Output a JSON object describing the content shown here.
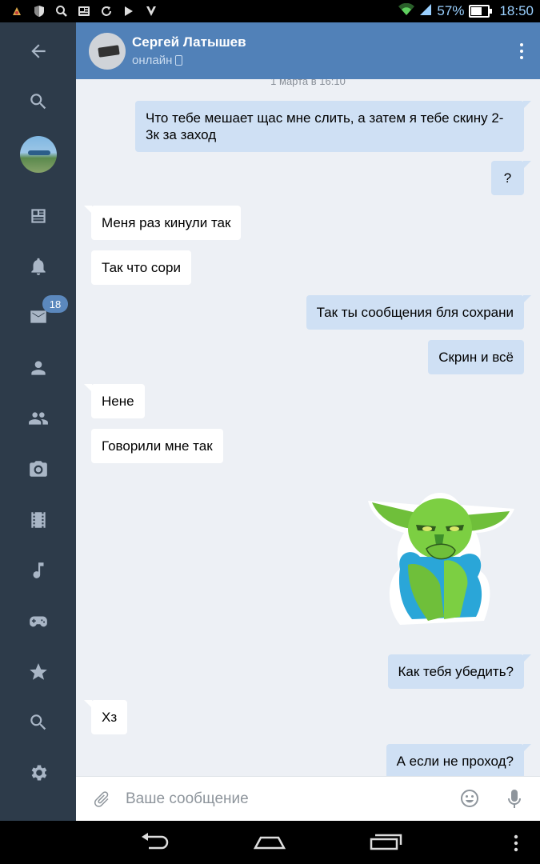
{
  "status_bar": {
    "battery_percent": "57%",
    "battery_level": 0.57,
    "time": "18:50",
    "left_icons": [
      "notification-app-icon",
      "shield-icon",
      "search-icon",
      "news-icon",
      "sync-icon",
      "play-icon",
      "store-icon"
    ],
    "right_icons": [
      "wifi-icon",
      "signal-icon",
      "battery-icon"
    ]
  },
  "sidebar": {
    "unread_badge": "18",
    "items": [
      "back-arrow-icon",
      "search-icon",
      "profile-avatar",
      "news-icon",
      "bell-icon",
      "mail-icon",
      "person-icon",
      "people-icon",
      "camera-icon",
      "film-icon",
      "music-icon",
      "gamepad-icon",
      "star-icon",
      "search-icon",
      "gear-icon"
    ]
  },
  "header": {
    "contact_name": "Сергей Латышев",
    "status": "онлайн"
  },
  "chat": {
    "date_label": "1 марта в 16:10",
    "messages": [
      {
        "dir": "out",
        "text": "Что тебе мешает щас мне слить, а затем я тебе скину 2-3к за заход"
      },
      {
        "dir": "out",
        "text": "?"
      },
      {
        "dir": "in",
        "text": "Меня раз кинули так"
      },
      {
        "dir": "in",
        "text": "Так что сори"
      },
      {
        "dir": "out",
        "text": "Так ты сообщения бля сохрани"
      },
      {
        "dir": "out",
        "text": "Скрин и всё"
      },
      {
        "dir": "in",
        "text": "Нене"
      },
      {
        "dir": "in",
        "text": "Говорили мне так"
      },
      {
        "dir": "in",
        "text": "sticker"
      },
      {
        "dir": "out",
        "text": "Как тебя убедить?"
      },
      {
        "dir": "in",
        "text": "Хз"
      },
      {
        "dir": "out",
        "text": "А если не проход?"
      }
    ]
  },
  "input": {
    "placeholder": "Ваше сообщение"
  },
  "colors": {
    "header": "#5181b8",
    "sidebar": "#2d3b4a",
    "chat_bg": "#edf0f5",
    "outgoing_bubble": "#cfe0f4",
    "incoming_bubble": "#ffffff",
    "badge": "#5b88bd"
  }
}
